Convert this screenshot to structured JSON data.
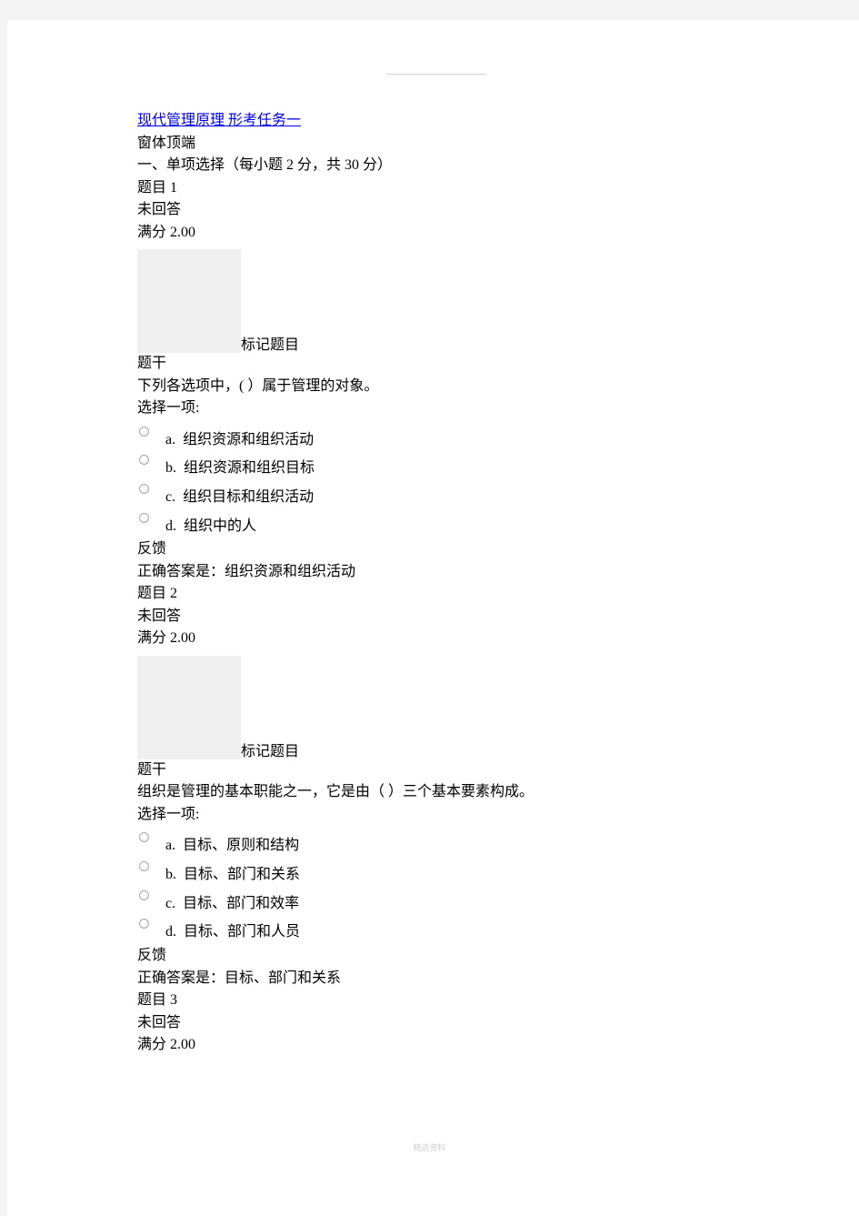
{
  "document": {
    "title_link": "现代管理原理  形考任务一",
    "form_top": "窗体顶端",
    "section_heading": "一、单项选择（每小题 2 分，共 30 分）"
  },
  "questions": [
    {
      "number_label": "题目 1",
      "status": "未回答",
      "score": "满分 2.00",
      "flag_label": "标记题目",
      "stem_label": "题干",
      "stem": "下列各选项中，(   ）属于管理的对象。",
      "prompt": "选择一项:",
      "options": [
        {
          "letter": "a.",
          "text": "组织资源和组织活动"
        },
        {
          "letter": "b.",
          "text": "组织资源和组织目标"
        },
        {
          "letter": "c.",
          "text": "组织目标和组织活动"
        },
        {
          "letter": "d.",
          "text": "组织中的人"
        }
      ],
      "feedback_label": "反馈",
      "correct_answer": "正确答案是：组织资源和组织活动"
    },
    {
      "number_label": "题目 2",
      "status": "未回答",
      "score": "满分 2.00",
      "flag_label": "标记题目",
      "stem_label": "题干",
      "stem": "组织是管理的基本职能之一，它是由（     ）三个基本要素构成。",
      "prompt": "选择一项:",
      "options": [
        {
          "letter": "a.",
          "text": "目标、原则和结构"
        },
        {
          "letter": "b.",
          "text": "目标、部门和关系"
        },
        {
          "letter": "c.",
          "text": "目标、部门和效率"
        },
        {
          "letter": "d.",
          "text": "目标、部门和人员"
        }
      ],
      "feedback_label": "反馈",
      "correct_answer": "正确答案是：目标、部门和关系"
    },
    {
      "number_label": "题目 3",
      "status": "未回答",
      "score": "满分 2.00"
    }
  ],
  "footer": {
    "watermark": "精选资料"
  }
}
